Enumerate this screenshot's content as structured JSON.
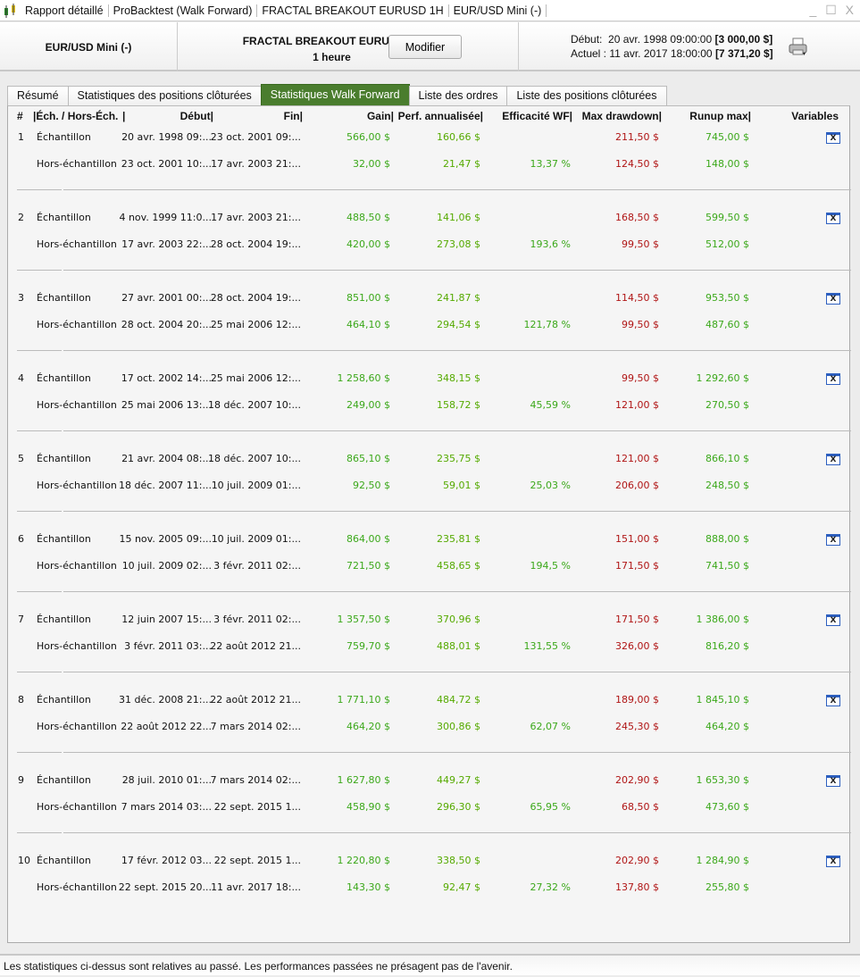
{
  "title_bar": {
    "segments": [
      "Rapport détaillé",
      "ProBacktest (Walk Forward)",
      "FRACTAL BREAKOUT EURUSD 1H",
      "EUR/USD Mini (-)"
    ],
    "window_controls": "_ ☐ X"
  },
  "header": {
    "instrument": "EUR/USD Mini (-)",
    "strategy_name": "FRACTAL BREAKOUT EURUSD 1H",
    "timeframe": "1 heure",
    "modify_label": "Modifier",
    "start_label": "Début:",
    "start_value": "20 avr. 1998 09:00:00",
    "start_capital": "[3 000,00 $]",
    "current_label": "Actuel :",
    "current_value": "11 avr. 2017 18:00:00",
    "current_capital": "[7 371,20 $]"
  },
  "tabs": [
    {
      "label": "Résumé"
    },
    {
      "label": "Statistiques des positions clôturées"
    },
    {
      "label": "Statistiques Walk Forward",
      "active": true
    },
    {
      "label": "Liste des ordres"
    },
    {
      "label": "Liste des positions clôturées"
    }
  ],
  "columns": [
    "#",
    "|Éch. / Hors-Éch.",
    "|",
    "Début|",
    "Fin|",
    "Gain|",
    "Perf. annualisée|",
    "Efficacité WF|",
    "Max drawdown|",
    "Runup max|",
    "Variables"
  ],
  "rows": [
    {
      "n": "1",
      "s": [
        "Échantillon",
        "20 avr. 1998 09:...",
        "23 oct. 2001 09:...",
        "566,00 $",
        "160,66 $",
        "",
        "211,50 $",
        "745,00 $"
      ],
      "o": [
        "Hors-échantillon",
        "23 oct. 2001 10:...",
        "17 avr. 2003 21:...",
        "32,00 $",
        "21,47 $",
        "13,37 %",
        "124,50 $",
        "148,00 $"
      ]
    },
    {
      "n": "2",
      "s": [
        "Échantillon",
        "4 nov. 1999 11:0...",
        "17 avr. 2003 21:...",
        "488,50 $",
        "141,06 $",
        "",
        "168,50 $",
        "599,50 $"
      ],
      "o": [
        "Hors-échantillon",
        "17 avr. 2003 22:...",
        "28 oct. 2004 19:...",
        "420,00 $",
        "273,08 $",
        "193,6 %",
        "99,50 $",
        "512,00 $"
      ]
    },
    {
      "n": "3",
      "s": [
        "Échantillon",
        "27 avr. 2001 00:...",
        "28 oct. 2004 19:...",
        "851,00 $",
        "241,87 $",
        "",
        "114,50 $",
        "953,50 $"
      ],
      "o": [
        "Hors-échantillon",
        "28 oct. 2004 20:...",
        "25 mai 2006 12:...",
        "464,10 $",
        "294,54 $",
        "121,78 %",
        "99,50 $",
        "487,60 $"
      ]
    },
    {
      "n": "4",
      "s": [
        "Échantillon",
        "17 oct. 2002 14:...",
        "25 mai 2006 12:...",
        "1 258,60 $",
        "348,15 $",
        "",
        "99,50 $",
        "1 292,60 $"
      ],
      "o": [
        "Hors-échantillon",
        "25 mai 2006 13:...",
        "18 déc. 2007 10:...",
        "249,00 $",
        "158,72 $",
        "45,59 %",
        "121,00 $",
        "270,50 $"
      ]
    },
    {
      "n": "5",
      "s": [
        "Échantillon",
        "21 avr. 2004 08:...",
        "18 déc. 2007 10:...",
        "865,10 $",
        "235,75 $",
        "",
        "121,00 $",
        "866,10 $"
      ],
      "o": [
        "Hors-échantillon",
        "18 déc. 2007 11:...",
        "10 juil. 2009 01:...",
        "92,50 $",
        "59,01 $",
        "25,03 %",
        "206,00 $",
        "248,50 $"
      ]
    },
    {
      "n": "6",
      "s": [
        "Échantillon",
        "15 nov. 2005 09:...",
        "10 juil. 2009 01:...",
        "864,00 $",
        "235,81 $",
        "",
        "151,00 $",
        "888,00 $"
      ],
      "o": [
        "Hors-échantillon",
        "10 juil. 2009 02:...",
        "3 févr. 2011 02:...",
        "721,50 $",
        "458,65 $",
        "194,5 %",
        "171,50 $",
        "741,50 $"
      ]
    },
    {
      "n": "7",
      "s": [
        "Échantillon",
        "12 juin 2007 15:...",
        "3 févr. 2011 02:...",
        "1 357,50 $",
        "370,96 $",
        "",
        "171,50 $",
        "1 386,00 $"
      ],
      "o": [
        "Hors-échantillon",
        "3 févr. 2011 03:...",
        "22 août 2012 21...",
        "759,70 $",
        "488,01 $",
        "131,55 %",
        "326,00 $",
        "816,20 $"
      ]
    },
    {
      "n": "8",
      "s": [
        "Échantillon",
        "31 déc. 2008 21:...",
        "22 août 2012 21...",
        "1 771,10 $",
        "484,72 $",
        "",
        "189,00 $",
        "1 845,10 $"
      ],
      "o": [
        "Hors-échantillon",
        "22 août 2012 22...",
        "7 mars 2014 02:...",
        "464,20 $",
        "300,86 $",
        "62,07 %",
        "245,30 $",
        "464,20 $"
      ]
    },
    {
      "n": "9",
      "s": [
        "Échantillon",
        "28 juil. 2010 01:...",
        "7 mars 2014 02:...",
        "1 627,80 $",
        "449,27 $",
        "",
        "202,90 $",
        "1 653,30 $"
      ],
      "o": [
        "Hors-échantillon",
        "7 mars 2014 03:...",
        "22 sept. 2015 1...",
        "458,90 $",
        "296,30 $",
        "65,95 %",
        "68,50 $",
        "473,60 $"
      ]
    },
    {
      "n": "10",
      "s": [
        "Échantillon",
        "17 févr. 2012 03...",
        "22 sept. 2015 1...",
        "1 220,80 $",
        "338,50 $",
        "",
        "202,90 $",
        "1 284,90 $"
      ],
      "o": [
        "Hors-échantillon",
        "22 sept. 2015 20...",
        "11 avr. 2017 18:...",
        "143,30 $",
        "92,47 $",
        "27,32 %",
        "137,80 $",
        "255,80 $"
      ]
    }
  ],
  "variables_icon": "X",
  "footer": "Les statistiques ci-dessus sont relatives au passé. Les performances passées ne présagent pas de l'avenir.",
  "colors": {
    "gain": "#3ba81a",
    "drawdown": "#b01515",
    "active_tab": "#4a7d2e"
  }
}
